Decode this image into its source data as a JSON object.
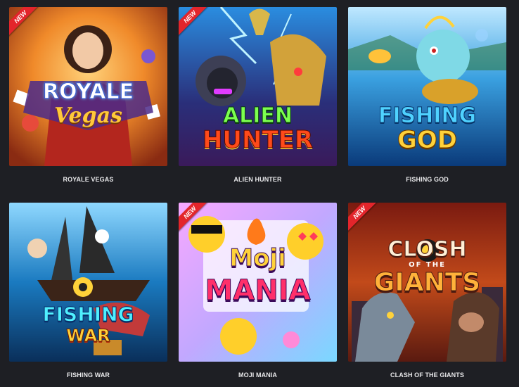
{
  "games": [
    {
      "title": "ROYALE VEGAS",
      "badge": "NEW",
      "logo_line1": "ROYALE",
      "logo_line2": "Vegas"
    },
    {
      "title": "ALIEN HUNTER",
      "badge": "NEW",
      "logo_line1": "ALIEN",
      "logo_line2": "HUNTER"
    },
    {
      "title": "FISHING GOD",
      "badge": "",
      "logo_line1": "FISHING",
      "logo_line2": "GOD"
    },
    {
      "title": "FISHING WAR",
      "badge": "",
      "logo_line1": "FISHING",
      "logo_line2": "WAR"
    },
    {
      "title": "MOJI MANIA",
      "badge": "NEW",
      "logo_line1": "Moji",
      "logo_line2": "MANIA"
    },
    {
      "title": "CLASH OF THE GIANTS",
      "badge": "NEW",
      "logo_line1": "CLOSH",
      "logo_line_mid": "OF THE",
      "logo_line2": "GIANTS"
    }
  ],
  "colors": {
    "background": "#1e1f24",
    "badge": "#e3252b",
    "title_text": "#e8e8ea"
  }
}
